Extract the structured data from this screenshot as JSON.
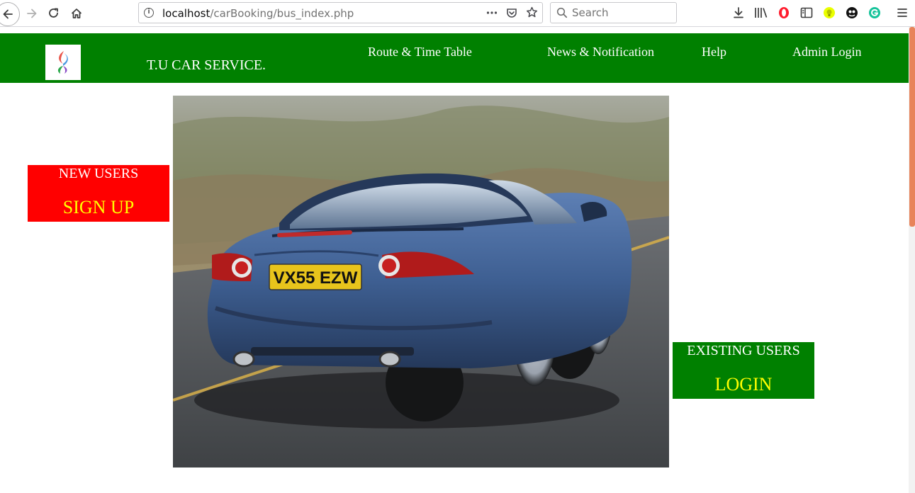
{
  "browser": {
    "url_host": "localhost",
    "url_path": "/carBooking/bus_index.php",
    "search_placeholder": "Search",
    "icons": [
      "back-icon",
      "forward-icon",
      "reload-icon",
      "home-icon",
      "info-icon",
      "more-icon",
      "pocket-icon",
      "bookmark-star-icon",
      "search-icon",
      "download-icon",
      "library-icon",
      "opera-icon",
      "sidebar-icon",
      "bulb-icon",
      "ghost-icon",
      "grammarly-icon",
      "menu-icon"
    ]
  },
  "header": {
    "site_title": "T.U CAR SERVICE.",
    "nav": {
      "route": "Route & Time Table",
      "news": "News & Notification",
      "help": "Help",
      "admin": "Admin Login"
    }
  },
  "signup": {
    "label": "NEW USERS",
    "action": "SIGN UP"
  },
  "login": {
    "label": "EXISTING USERS",
    "action": "LOGIN"
  },
  "hero": {
    "plate": "VX55 EZW"
  },
  "colors": {
    "header_bg": "#008000",
    "signup_bg": "#ff0000",
    "login_bg": "#008000",
    "cta_action": "#ffff00",
    "car_body": "#3e5f92"
  }
}
